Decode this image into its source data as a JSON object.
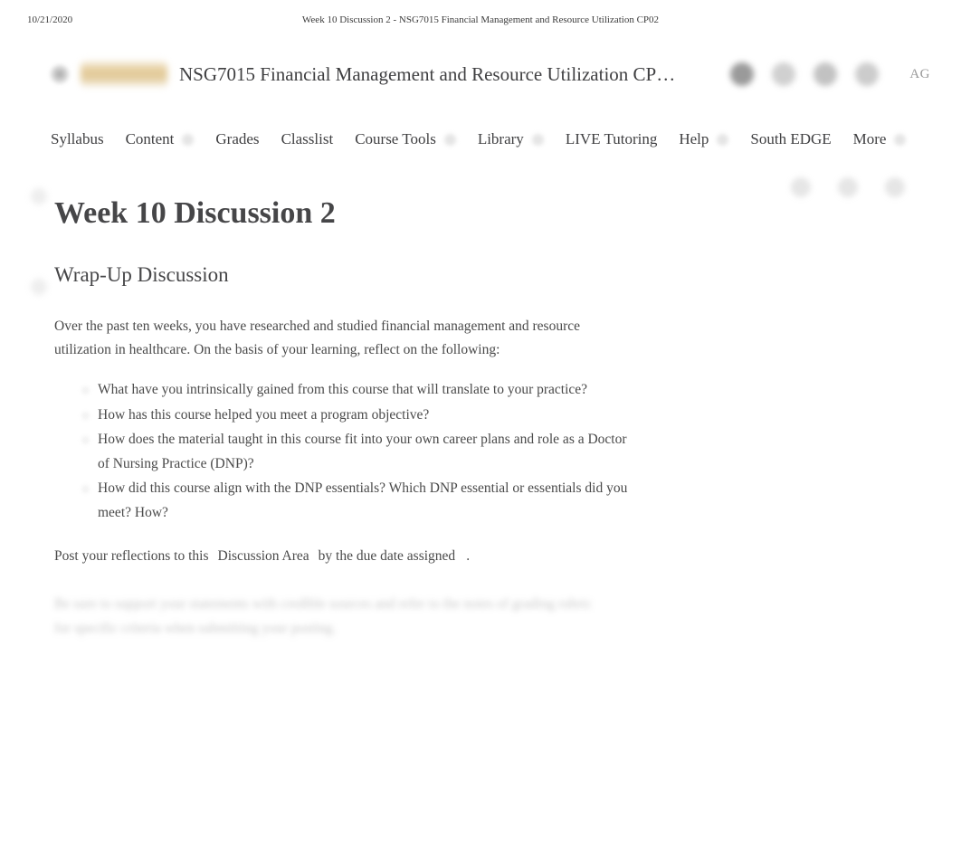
{
  "print_header": {
    "date": "10/21/2020",
    "document_title": "Week 10 Discussion 2 - NSG7015 Financial Management and Resource Utilization CP02"
  },
  "course_header": {
    "course_title": "NSG7015 Financial Management and Resource Utilization CP…",
    "logo_color": "#e2c791",
    "avatar_initials": "AG",
    "tool_icons": [
      {
        "name": "notifications-icon"
      },
      {
        "name": "message-icon"
      },
      {
        "name": "subscriptions-icon"
      },
      {
        "name": "account-icon"
      }
    ]
  },
  "navbar": {
    "items": [
      {
        "label": "Syllabus",
        "has_caret": false
      },
      {
        "label": "Content",
        "has_caret": true
      },
      {
        "label": "Grades",
        "has_caret": false
      },
      {
        "label": "Classlist",
        "has_caret": false
      },
      {
        "label": "Course Tools",
        "has_caret": true
      },
      {
        "label": "Library",
        "has_caret": true
      },
      {
        "label": "LIVE Tutoring",
        "has_caret": false
      },
      {
        "label": "Help",
        "has_caret": true
      },
      {
        "label": "South EDGE",
        "has_caret": false
      },
      {
        "label": "More",
        "has_caret": true
      }
    ]
  },
  "page": {
    "title": "Week 10 Discussion 2",
    "actions": [
      {
        "name": "print-icon"
      },
      {
        "name": "settings-icon"
      },
      {
        "name": "more-options-icon"
      }
    ]
  },
  "main": {
    "section_heading": "Wrap-Up Discussion",
    "intro_paragraph": "Over the past ten weeks, you have researched and studied financial management and resource utilization in healthcare. On the basis of your learning, reflect on the following:",
    "questions": [
      "What have you intrinsically gained from this course that will translate to your practice?",
      "How has this course helped you meet a program objective?",
      "How does the material taught in this course fit into your own career plans and role as a Doctor of Nursing Practice (DNP)?",
      "How did this course align with the DNP essentials? Which DNP essential or essentials did you meet? How?"
    ],
    "closing": {
      "before_link": "Post your reflections to this",
      "link_text": "Discussion Area",
      "after_link": "by the due date assigned",
      "trailing": "."
    },
    "obscured_note": "Be sure to support your statements with credible sources and refer to the notes of grading rubric for specific criteria when submitting your posting."
  }
}
